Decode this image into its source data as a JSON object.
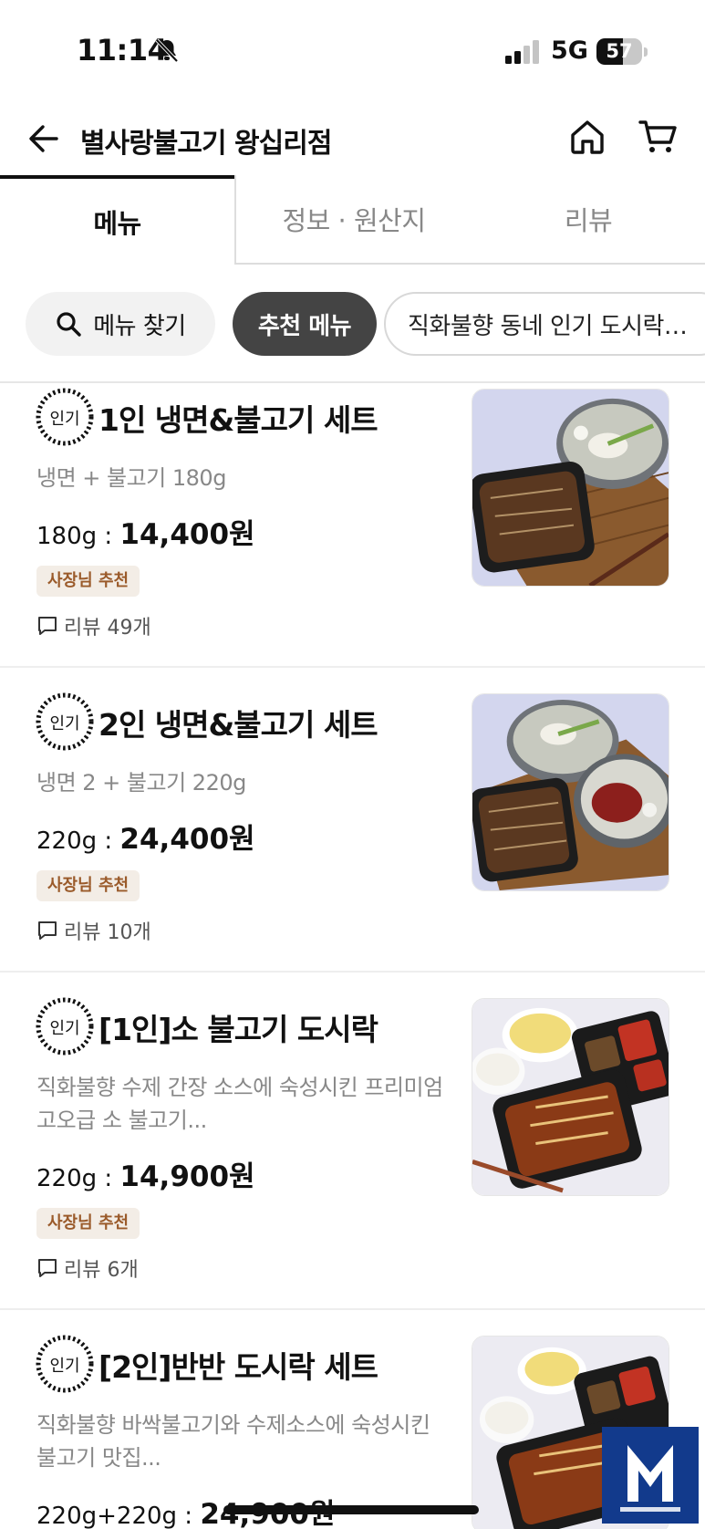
{
  "status_bar": {
    "time": "11:14",
    "network": "5G",
    "battery": "57",
    "battery_level": 0.57,
    "icons": [
      "bell-muted-icon",
      "signal-icon",
      "battery-icon"
    ]
  },
  "header": {
    "title": "별사랑불고기 왕십리점",
    "icons": [
      "back-arrow-icon",
      "home-icon",
      "cart-icon"
    ]
  },
  "tabs": [
    {
      "label": "메뉴",
      "active": true
    },
    {
      "label": "정보 · 원산지",
      "active": false
    },
    {
      "label": "리뷰",
      "active": false
    }
  ],
  "chips": {
    "search": "메뉴 찾기",
    "recommended": "추천 메뉴",
    "popular": "직화불향 동네 인기 도시락…"
  },
  "popular_badge_label": "인기",
  "menu_items": [
    {
      "name": "1인 냉면&불고기 세트",
      "desc": "냉면 + 불고기 180g",
      "price_prefix": "180g : ",
      "price": "14,400원",
      "badge": "사장님 추천",
      "review": "리뷰 49개"
    },
    {
      "name": "2인 냉면&불고기 세트",
      "desc": "냉면 2 + 불고기 220g",
      "price_prefix": "220g : ",
      "price": "24,400원",
      "badge": "사장님 추천",
      "review": "리뷰 10개"
    },
    {
      "name": "[1인]소 불고기 도시락",
      "desc": "직화불향 수제 간장 소스에 숙성시킨 프리미엄 고오급 소 불고기...",
      "price_prefix": "220g : ",
      "price": "14,900원",
      "badge": "사장님 추천",
      "review": "리뷰 6개"
    },
    {
      "name": "[2인]반반 도시락 세트",
      "desc": "직화불향 바싹불고기와 수제소스에 숙성시킨 불고기 맛집...",
      "price_prefix": "220g+220g : ",
      "price": "24,900원"
    }
  ],
  "colors": {
    "accent_dark": "#444444",
    "owner_badge_bg": "#f3ede6",
    "owner_badge_text": "#9a5a2a"
  }
}
